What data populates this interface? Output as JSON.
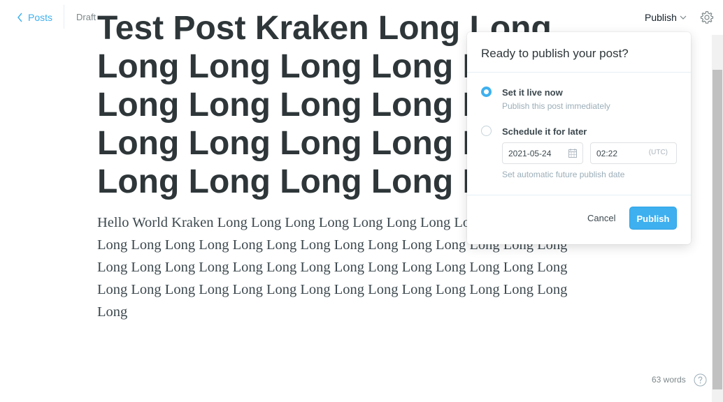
{
  "header": {
    "back_label": "Posts",
    "status": "Draft",
    "publish_menu_label": "Publish"
  },
  "post": {
    "title": "Test Post Kraken Long Long Long Long Long Long Long Long Long Long Long Long Long Long Long Long Long Long Long Long Long Long",
    "body": "Hello World Kraken Long Long Long Long Long Long Long Long Long Long Long Long Long Long Long Long Long Long Long Long Long Long Long Long Long Long Long Long Long Long Long Long Long Long Long Long Long Long Long Long Long Long Long Long Long Long Long Long Long Long Long Long Long Long"
  },
  "footer": {
    "word_count": "63 words",
    "help_icon": "question-mark-circle"
  },
  "publish_popover": {
    "title": "Ready to publish your post?",
    "options": [
      {
        "label": "Set it live now",
        "description": "Publish this post immediately",
        "selected": true
      },
      {
        "label": "Schedule it for later",
        "description": "",
        "selected": false
      }
    ],
    "schedule": {
      "date": "2021-05-24",
      "time": "02:22",
      "timezone": "(UTC)",
      "hint": "Set automatic future publish date"
    },
    "cancel_label": "Cancel",
    "publish_label": "Publish"
  },
  "colors": {
    "accent": "#3eb0ef",
    "text_dark": "#2e3639",
    "text_muted": "#9baeb8"
  },
  "icons": [
    "chevron-left-icon",
    "chevron-down-icon",
    "gear-icon",
    "calendar-icon",
    "help-icon"
  ]
}
